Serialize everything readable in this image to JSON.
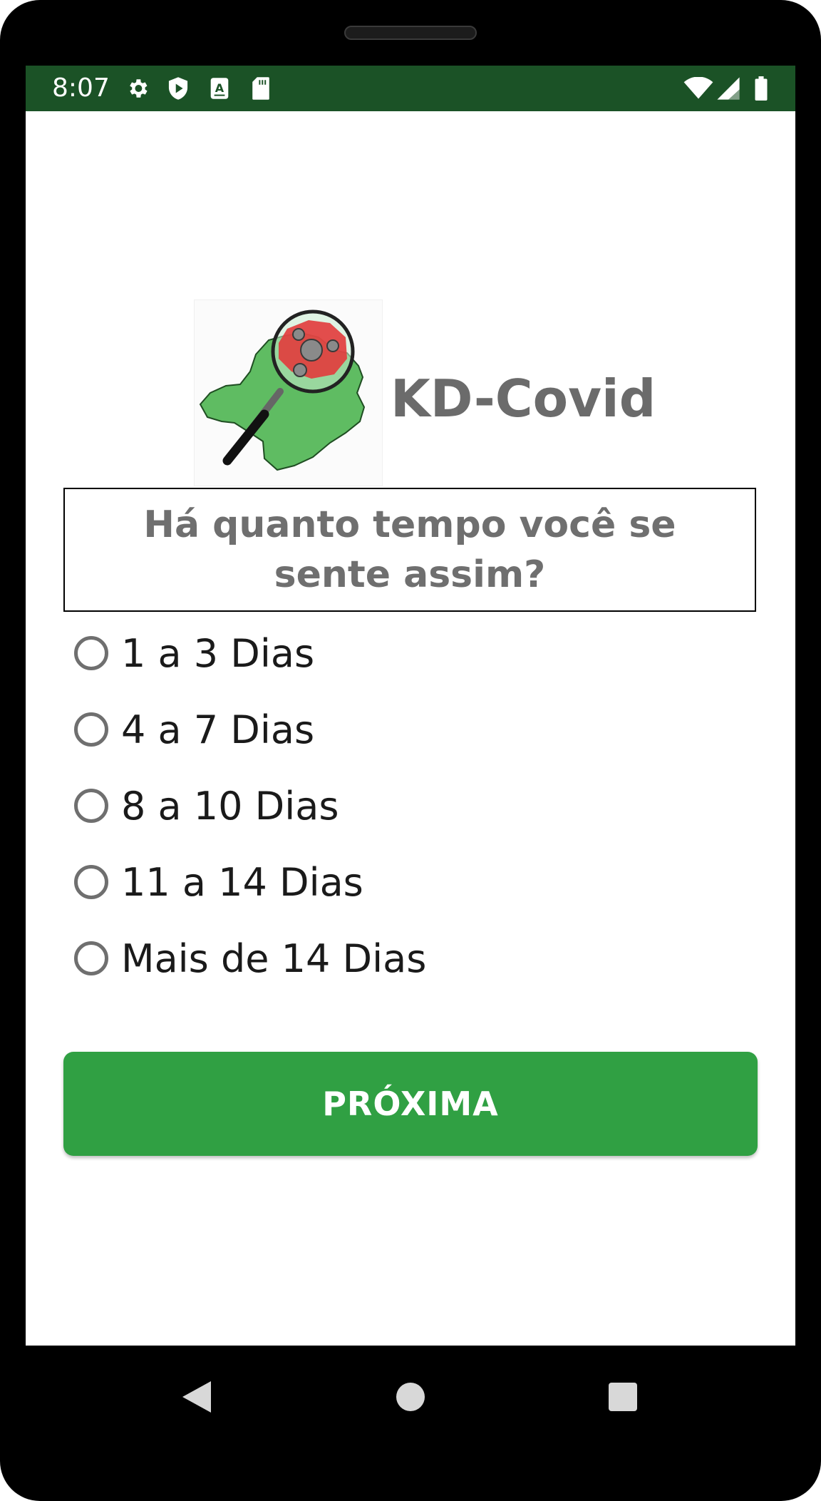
{
  "status_bar": {
    "time": "8:07",
    "icons": [
      "settings-icon",
      "shield-play-icon",
      "text-a-icon",
      "sd-card-icon",
      "wifi-icon",
      "signal-icon",
      "battery-icon"
    ]
  },
  "app": {
    "title": "KD-Covid"
  },
  "question": {
    "text": "Há quanto tempo você se sente assim?"
  },
  "options": [
    {
      "label": "1 a 3 Dias",
      "selected": false
    },
    {
      "label": "4 a 7 Dias",
      "selected": false
    },
    {
      "label": "8 a 10 Dias",
      "selected": false
    },
    {
      "label": "11 a 14 Dias",
      "selected": false
    },
    {
      "label": "Mais de 14 Dias",
      "selected": false
    }
  ],
  "next_button": {
    "label": "PRÓXIMA"
  },
  "nav_bar": {
    "icons": [
      "back-icon",
      "home-icon",
      "recents-icon"
    ]
  },
  "colors": {
    "status_bar": "#1b5226",
    "button": "#30a043",
    "title_text": "#6b6b6b"
  }
}
